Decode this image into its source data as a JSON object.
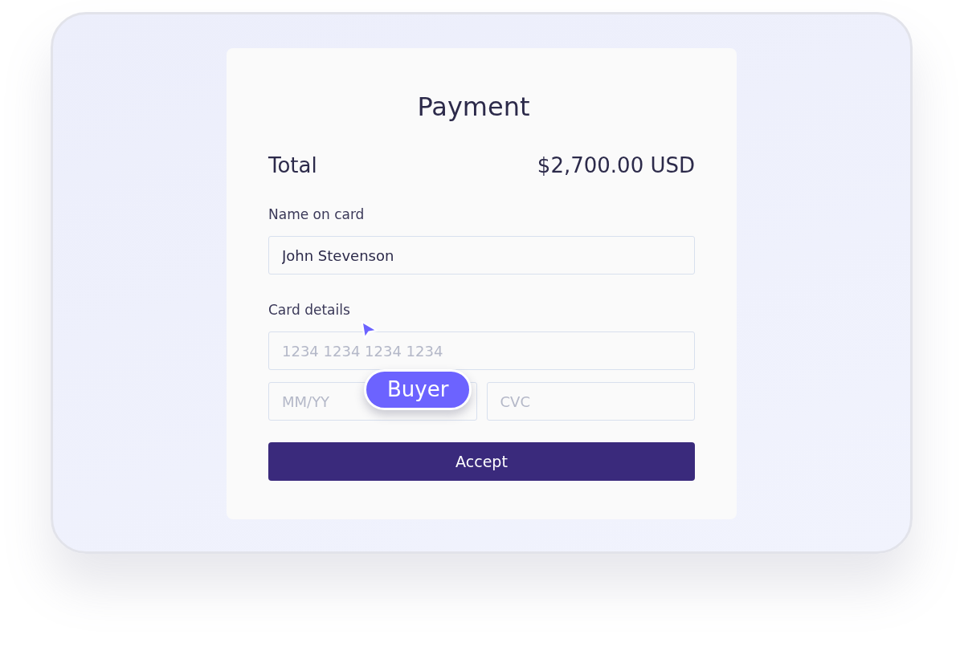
{
  "title": "Payment",
  "total": {
    "label": "Total",
    "amount": "$2,700.00 USD"
  },
  "name_field": {
    "label": "Name on card",
    "value": "John Stevenson"
  },
  "card_details": {
    "label": "Card details",
    "number_placeholder": "1234 1234 1234 1234",
    "expiry_placeholder": "MM/YY",
    "cvc_placeholder": "CVC"
  },
  "button": "Accept",
  "cursor": {
    "label": "Buyer"
  }
}
